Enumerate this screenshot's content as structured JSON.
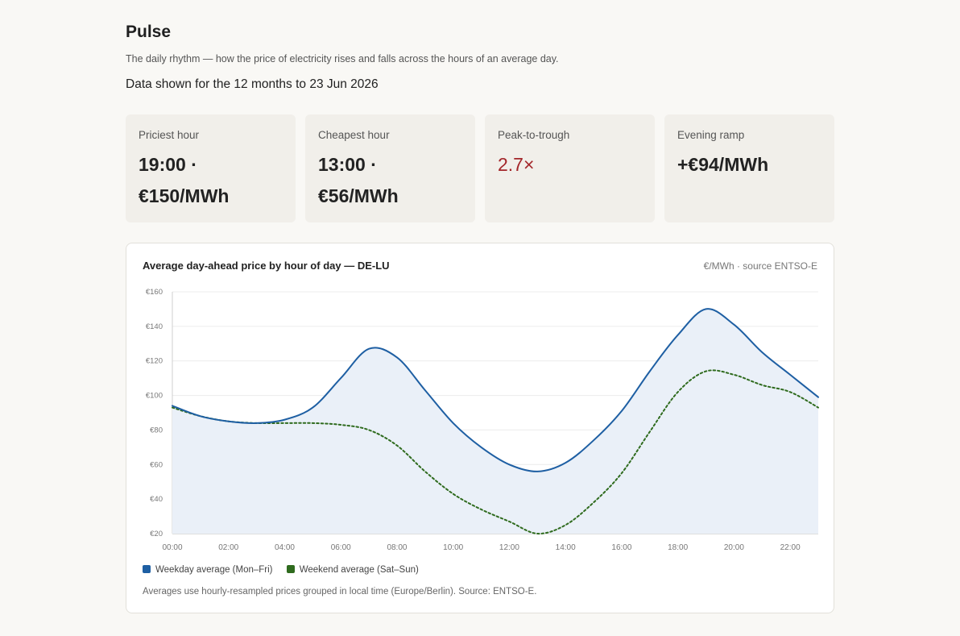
{
  "header": {
    "title": "Pulse",
    "subtitle": "The daily rhythm — how the price of electricity rises and falls across the hours of an average day.",
    "range": "Data shown for the 12 months to 23 Jun 2026"
  },
  "cards": [
    {
      "label": "Priciest hour",
      "value": "19:00 · €150/MWh"
    },
    {
      "label": "Cheapest hour",
      "value": "13:00 · €56/MWh"
    },
    {
      "label": "Peak-to-trough",
      "value": "2.7×"
    },
    {
      "label": "Evening ramp",
      "value": "+€94/MWh"
    }
  ],
  "chart": {
    "title": "Average day-ahead price by hour of day — DE-LU",
    "units": "€/MWh · source ENTSO-E",
    "note": "Averages use hourly-resampled prices grouped in local time (Europe/Berlin). Source: ENTSO-E."
  },
  "colors": {
    "weekday": "#1e5fa3",
    "weekend": "#2f6b1e",
    "fill": "#eaf0f8",
    "accent_red": "#a3262a"
  },
  "chart_data": {
    "type": "line",
    "x": [
      "00:00",
      "01:00",
      "02:00",
      "03:00",
      "04:00",
      "05:00",
      "06:00",
      "07:00",
      "08:00",
      "09:00",
      "10:00",
      "11:00",
      "12:00",
      "13:00",
      "14:00",
      "15:00",
      "16:00",
      "17:00",
      "18:00",
      "19:00",
      "20:00",
      "21:00",
      "22:00",
      "23:00"
    ],
    "x_ticks": [
      "00:00",
      "02:00",
      "04:00",
      "06:00",
      "08:00",
      "10:00",
      "12:00",
      "14:00",
      "16:00",
      "18:00",
      "20:00",
      "22:00"
    ],
    "y_ticks": [
      "€20",
      "€40",
      "€60",
      "€80",
      "€100",
      "€120",
      "€140",
      "€160"
    ],
    "ylim": [
      20,
      160
    ],
    "grid": true,
    "legend_position": "bottom-left",
    "series": [
      {
        "name": "Weekday average (Mon–Fri)",
        "style": "solid",
        "area": true,
        "values": [
          94,
          88,
          85,
          84,
          86,
          93,
          110,
          127,
          122,
          103,
          84,
          70,
          60,
          56,
          61,
          74,
          91,
          114,
          135,
          150,
          141,
          125,
          112,
          99
        ]
      },
      {
        "name": "Weekend average (Sat–Sun)",
        "style": "dotted",
        "area": false,
        "values": [
          93,
          88,
          85,
          84,
          84,
          84,
          83,
          80,
          71,
          56,
          43,
          34,
          27,
          20,
          25,
          38,
          55,
          79,
          102,
          114,
          112,
          106,
          102,
          93
        ]
      }
    ]
  }
}
